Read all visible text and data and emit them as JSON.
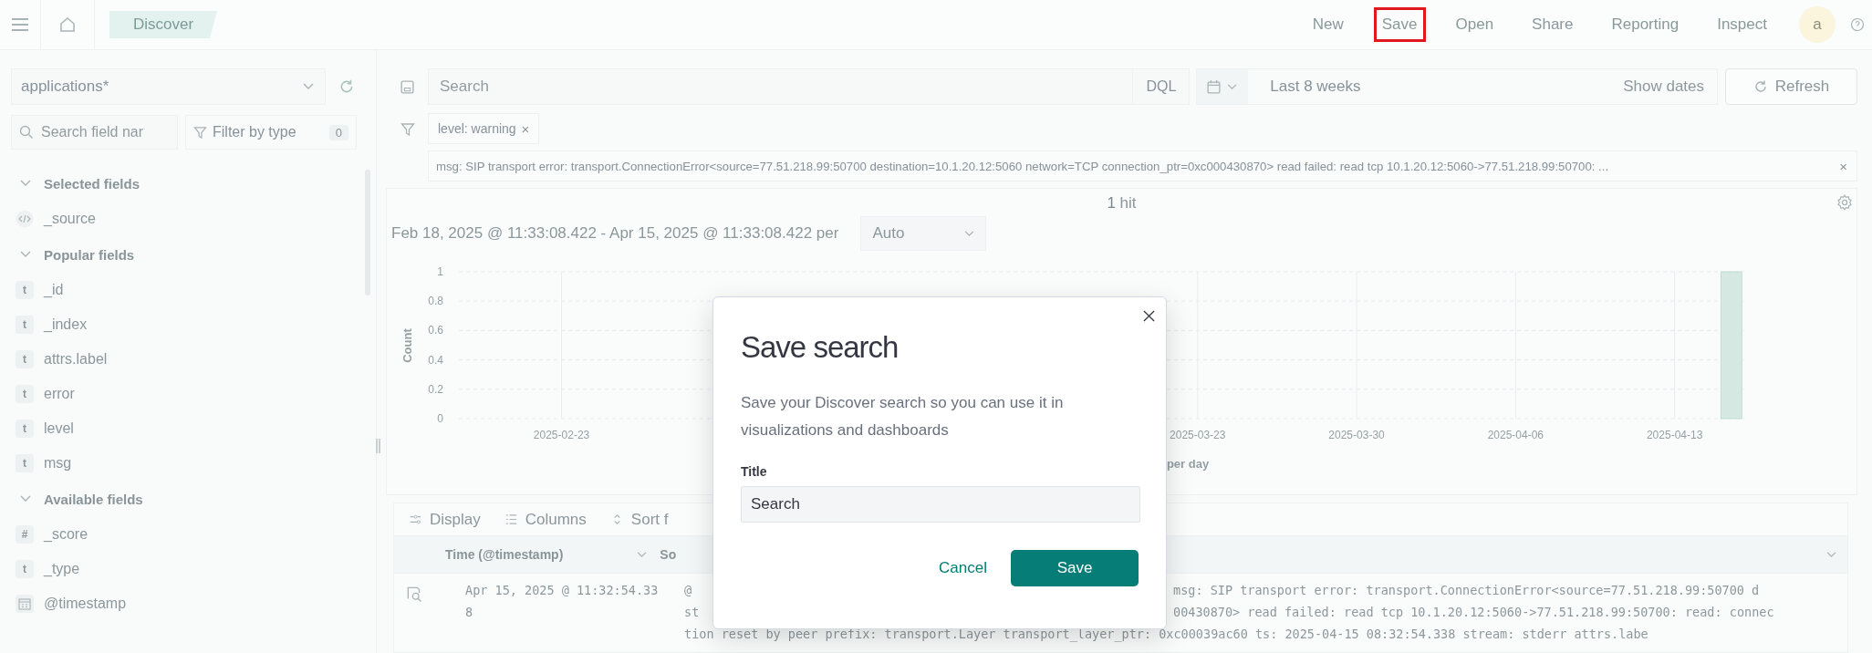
{
  "header": {
    "breadcrumb": "Discover",
    "nav": [
      {
        "label": "New",
        "highlighted": false
      },
      {
        "label": "Save",
        "highlighted": true
      },
      {
        "label": "Open",
        "highlighted": false
      },
      {
        "label": "Share",
        "highlighted": false
      },
      {
        "label": "Reporting",
        "highlighted": false
      },
      {
        "label": "Inspect",
        "highlighted": false
      }
    ],
    "avatar": "a"
  },
  "sidebar": {
    "index_pattern": "applications*",
    "search": {
      "placeholder": "Search field nar"
    },
    "filter_button": {
      "label": "Filter by type",
      "count": "0"
    },
    "sections": [
      {
        "title": "Selected fields",
        "expanded": true,
        "fields": [
          {
            "name": "_source",
            "kind": "source"
          }
        ]
      },
      {
        "title": "Popular fields",
        "expanded": true,
        "fields": [
          {
            "name": "_id",
            "kind": "string",
            "token": "t"
          },
          {
            "name": "_index",
            "kind": "string",
            "token": "t"
          },
          {
            "name": "attrs.label",
            "kind": "string",
            "token": "t"
          },
          {
            "name": "error",
            "kind": "string",
            "token": "t"
          },
          {
            "name": "level",
            "kind": "string",
            "token": "t"
          },
          {
            "name": "msg",
            "kind": "string",
            "token": "t"
          }
        ]
      },
      {
        "title": "Available fields",
        "expanded": true,
        "fields": [
          {
            "name": "_score",
            "kind": "number",
            "token": "#"
          },
          {
            "name": "_type",
            "kind": "string",
            "token": "t"
          },
          {
            "name": "@timestamp",
            "kind": "date"
          }
        ]
      }
    ]
  },
  "query": {
    "search": {
      "placeholder": "Search"
    },
    "language": "DQL",
    "date_range": "Last 8 weeks",
    "show_dates": "Show dates",
    "refresh": "Refresh"
  },
  "filters": [
    {
      "label": "level: warning",
      "remove": "×"
    },
    {
      "label": "msg: SIP transport error: transport.ConnectionError<source=77.51.218.99:50700 destination=10.1.20.12:5060 network=TCP connection_ptr=0xc000430870> read failed: read tcp 10.1.20.12:5060->77.51.218.99:50700: ...",
      "remove": "×"
    }
  ],
  "histogram": {
    "hits": "1",
    "hits_label": "hit",
    "interval_text": "Feb 18, 2025 @ 11:33:08.422 - Apr 15, 2025 @ 11:33:08.422 per",
    "interval": "Auto",
    "chart_data": {
      "type": "bar",
      "grid": true,
      "xlabel": "per day",
      "ylabel": "Count",
      "ylim": [
        0,
        1
      ],
      "yticks": [
        0,
        0.2,
        0.4,
        0.6,
        0.8,
        1
      ],
      "categories": [
        null,
        null,
        null,
        null,
        null,
        "2025-02-23",
        null,
        null,
        null,
        null,
        null,
        null,
        null,
        null,
        null,
        null,
        null,
        null,
        null,
        null,
        null,
        null,
        null,
        null,
        null,
        null,
        null,
        null,
        null,
        null,
        null,
        null,
        null,
        "2025-03-23",
        null,
        null,
        null,
        null,
        null,
        null,
        "2025-03-30",
        null,
        null,
        null,
        null,
        null,
        null,
        "2025-04-06",
        null,
        null,
        null,
        null,
        null,
        null,
        "2025-04-13",
        null,
        null
      ],
      "values": [
        0,
        0,
        0,
        0,
        0,
        0,
        0,
        0,
        0,
        0,
        0,
        0,
        0,
        0,
        0,
        0,
        0,
        0,
        0,
        0,
        0,
        0,
        0,
        0,
        0,
        0,
        0,
        0,
        0,
        0,
        0,
        0,
        0,
        0,
        0,
        0,
        0,
        0,
        0,
        0,
        0,
        0,
        0,
        0,
        0,
        0,
        0,
        0,
        0,
        0,
        0,
        0,
        0,
        0,
        0,
        0,
        1
      ]
    }
  },
  "table": {
    "toolbar": [
      {
        "label": "Display",
        "kind": "display"
      },
      {
        "label": "Columns",
        "kind": "columns"
      },
      {
        "label": "Sort f",
        "kind": "sort"
      }
    ],
    "columns": [
      "Time (@timestamp)",
      "So"
    ],
    "rows": [
      {
        "time": [
          "Apr 15, 2025 @ 11:32:54.33",
          "8"
        ],
        "source_lines": [
          {
            "left": "@",
            "right": "msg: **SIP** **transport** **error**: **transport.ConnectionError**<**source**=**77.51.218.99**:**50700** d"
          },
          {
            "left": "**st**",
            "right": "**00430870**> **read** **failed**: **read** **tcp** **10.1.20.12**:**5060**->**77.51.218.99**:**50700**: **read**: **connec**"
          },
          {
            "left": "**tion** **reset** **by** **peer** prefix: transport.Layer transport_layer_ptr: 0xc00039ac60 ts: 2025-04-15 08:32:54.338 stream: stderr attrs.labe"
          }
        ]
      }
    ]
  },
  "modal": {
    "title": "Save search",
    "description": "Save your Discover search so you can use it in visualizations and dashboards",
    "field_label": "Title",
    "field_value": "Search",
    "cancel": "Cancel",
    "save": "Save"
  }
}
